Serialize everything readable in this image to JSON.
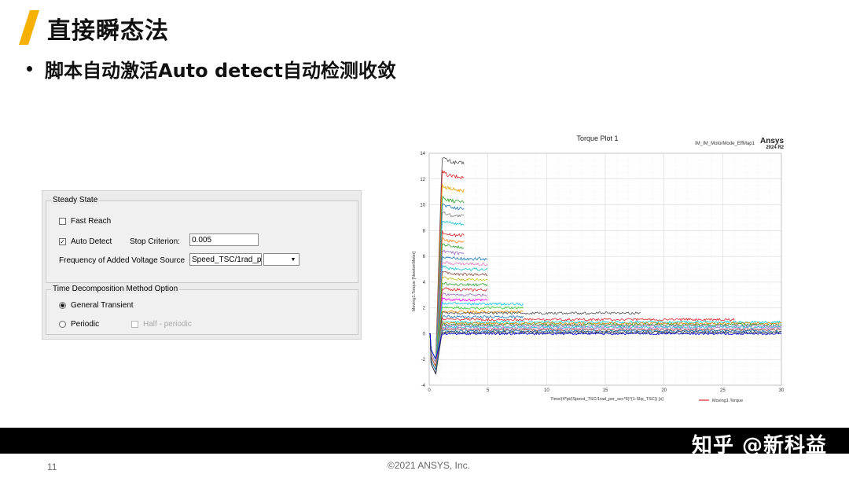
{
  "slide": {
    "title": "直接瞬态法",
    "bullet": "脚本自动激活Auto detect自动检测收敛",
    "accent_color": "#f5b000",
    "page_number": "11",
    "copyright": "©2021 ANSYS, Inc.",
    "watermark": "知乎 @新科益"
  },
  "dialog": {
    "steady_state": {
      "legend": "Steady State",
      "fast_reach": {
        "label": "Fast Reach",
        "checked": false
      },
      "auto_detect": {
        "label": "Auto Detect",
        "checked": true
      },
      "stop_criterion": {
        "label": "Stop Criterion:",
        "value": "0.005"
      },
      "frequency": {
        "label": "Frequency of Added Voltage Source",
        "value": "Speed_TSC/1rad_p",
        "selected": ""
      }
    },
    "time_decomposition": {
      "legend": "Time Decomposition Method Option",
      "general_transient": {
        "label": "General Transient",
        "selected": true
      },
      "periodic": {
        "label": "Periodic",
        "selected": false
      },
      "half_periodic": {
        "label": "Half - periodic",
        "enabled": false
      }
    }
  },
  "chart_data": {
    "type": "line",
    "title": "Torque Plot 1",
    "subtitle": "IM_IM_MotorMode_EffMap1",
    "brand": "Ansys",
    "version": "2024 R2",
    "xlabel": "Time/(4*pi/(Speed_TSC/1rad_per_sec*6)*(1-Slip_TSC)) [s]",
    "ylabel": "Moving1.Torque [NewtonMeter]",
    "xlim": [
      0,
      30
    ],
    "ylim": [
      -4,
      14
    ],
    "xticks": [
      0,
      5,
      10,
      15,
      20,
      25,
      30
    ],
    "yticks": [
      -4,
      -2,
      0,
      2,
      4,
      6,
      8,
      10,
      12,
      14
    ],
    "grid": true,
    "legend": {
      "placement": "bottom-right",
      "entries": [
        "Moving1.Torque"
      ]
    },
    "series_note": "Many overlapping torque traces settling to steady values; each ends at different times.",
    "series": [
      {
        "color": "#555555",
        "steady": 13.2,
        "end": 3.0
      },
      {
        "color": "#d62828",
        "steady": 12.1,
        "end": 3.0
      },
      {
        "color": "#e9a000",
        "steady": 11.1,
        "end": 3.0
      },
      {
        "color": "#2aa02a",
        "steady": 10.2,
        "end": 3.0
      },
      {
        "color": "#1f77b4",
        "steady": 9.7,
        "end": 3.0
      },
      {
        "color": "#7f7f7f",
        "steady": 9.1,
        "end": 3.0
      },
      {
        "color": "#17becf",
        "steady": 8.5,
        "end": 3.0
      },
      {
        "color": "#d62728",
        "steady": 7.6,
        "end": 3.0
      },
      {
        "color": "#ff7f0e",
        "steady": 7.1,
        "end": 3.0
      },
      {
        "color": "#2ca02c",
        "steady": 6.7,
        "end": 3.0
      },
      {
        "color": "#9467bd",
        "steady": 6.2,
        "end": 3.0
      },
      {
        "color": "#1f77b4",
        "steady": 5.8,
        "end": 5.0
      },
      {
        "color": "#e377c2",
        "steady": 5.4,
        "end": 5.0
      },
      {
        "color": "#17becf",
        "steady": 5.0,
        "end": 5.0
      },
      {
        "color": "#8c564b",
        "steady": 4.6,
        "end": 5.0
      },
      {
        "color": "#bcbd22",
        "steady": 4.2,
        "end": 5.0
      },
      {
        "color": "#2ca02c",
        "steady": 3.8,
        "end": 5.0
      },
      {
        "color": "#d62728",
        "steady": 3.4,
        "end": 5.0
      },
      {
        "color": "#9467bd",
        "steady": 3.0,
        "end": 5.0
      },
      {
        "color": "#ff00ff",
        "steady": 2.6,
        "end": 5.0
      },
      {
        "color": "#00bfff",
        "steady": 2.3,
        "end": 8.0
      },
      {
        "color": "#32cd32",
        "steady": 2.0,
        "end": 8.0
      },
      {
        "color": "#ff8c00",
        "steady": 1.7,
        "end": 8.0
      },
      {
        "color": "#555555",
        "steady": 1.6,
        "end": 18.0
      },
      {
        "color": "#1f77b4",
        "steady": 1.3,
        "end": 8.0
      },
      {
        "color": "#d62728",
        "steady": 1.1,
        "end": 26.0
      },
      {
        "color": "#00ced1",
        "steady": 0.9,
        "end": 30.0
      },
      {
        "color": "#ff7f0e",
        "steady": 0.8,
        "end": 30.0
      },
      {
        "color": "#2ca02c",
        "steady": 0.7,
        "end": 30.0
      },
      {
        "color": "#9467bd",
        "steady": 0.6,
        "end": 30.0
      },
      {
        "color": "#17becf",
        "steady": 0.5,
        "end": 30.0
      },
      {
        "color": "#e377c2",
        "steady": 0.4,
        "end": 30.0
      },
      {
        "color": "#8c564b",
        "steady": 0.3,
        "end": 30.0
      },
      {
        "color": "#1f77b4",
        "steady": 0.2,
        "end": 30.0
      },
      {
        "color": "#333333",
        "steady": 0.1,
        "end": 30.0
      },
      {
        "color": "#0000cd",
        "steady": 0.0,
        "end": 30.0
      }
    ]
  }
}
